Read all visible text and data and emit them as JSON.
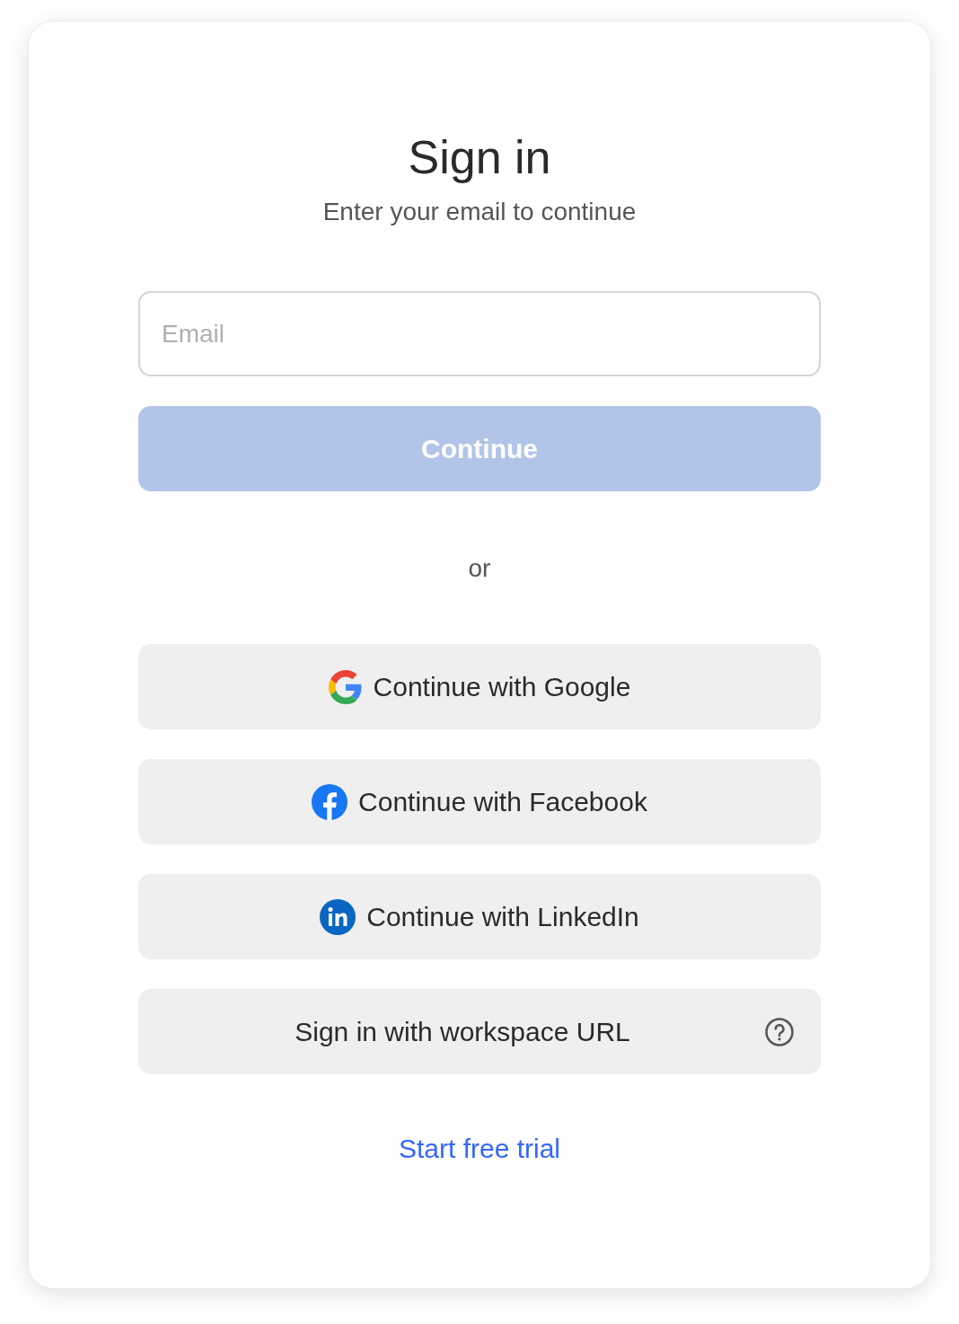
{
  "title": "Sign in",
  "subtitle": "Enter your email to continue",
  "email": {
    "placeholder": "Email"
  },
  "continue_button": {
    "label": "Continue",
    "disabled": true
  },
  "divider_text": "or",
  "providers": [
    {
      "kind": "google",
      "label": "Continue with Google"
    },
    {
      "kind": "facebook",
      "label": "Continue with Facebook"
    },
    {
      "kind": "linkedin",
      "label": "Continue with LinkedIn"
    },
    {
      "kind": "workspace",
      "label": "Sign in with workspace URL"
    }
  ],
  "trial_link": "Start free trial"
}
